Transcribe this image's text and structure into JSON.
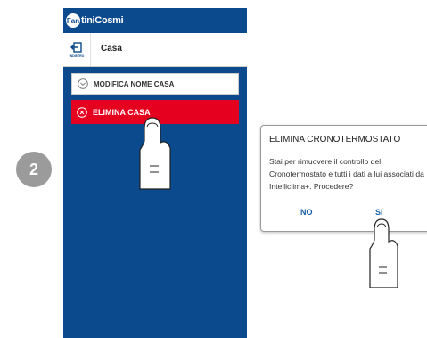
{
  "step": {
    "number": "2"
  },
  "app": {
    "logo_badge": "Fan",
    "logo_text": "tiniCosmi",
    "back_label": "INDIETRO",
    "house_title": "Casa"
  },
  "menu": {
    "rename_label": "MODIFICA NOME CASA",
    "delete_label": "ELIMINA CASA"
  },
  "dialog": {
    "title": "ELIMINA CRONOTERMOSTATO",
    "body": "Stai per rimuovere il controllo del Cronotermostato e tutti i dati a lui associati da Intelliclima+. Procedere?",
    "no_label": "NO",
    "yes_label": "SI"
  },
  "colors": {
    "brand_blue": "#0b4a8c",
    "delete_red": "#e5001f",
    "badge_gray": "#9b9b9b"
  }
}
